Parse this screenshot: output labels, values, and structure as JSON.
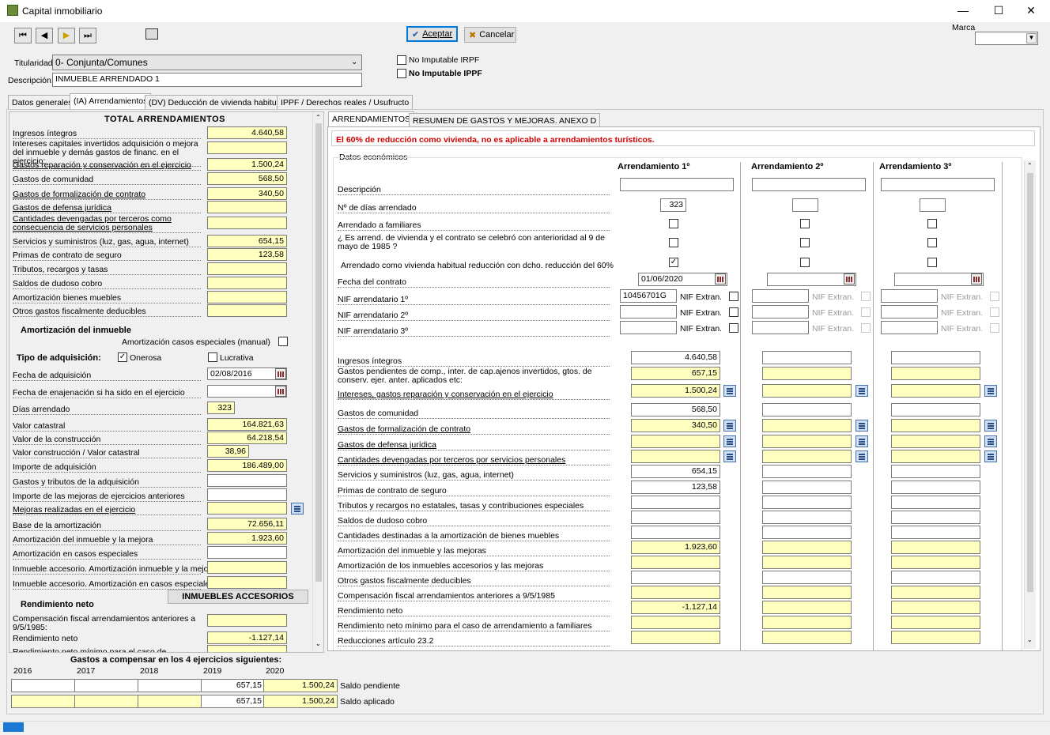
{
  "window": {
    "title": "Capital inmobiliario"
  },
  "toolbar": {
    "accept_label": "Aceptar",
    "cancel_label": "Cancelar",
    "marca_label": "Marca",
    "marca_value": ""
  },
  "header": {
    "titularidad_label": "Titularidad:",
    "titularidad_value": "0- Conjunta/Comunes",
    "descripcion_label": "Descripción:",
    "descripcion_value": "INMUEBLE ARRENDADO 1",
    "no_imputable_irpf": "No Imputable IRPF",
    "no_imputable_ippf": "No Imputable IPPF"
  },
  "tabs": [
    "Datos generales",
    "(IA) Arrendamientos",
    "(DV) Deducción de vivienda habitual",
    "IPPF / Derechos reales / Usufructo"
  ],
  "left": {
    "title": "TOTAL ARRENDAMIENTOS",
    "rows": [
      {
        "label": "Ingresos íntegros",
        "value": "4.640,58"
      },
      {
        "label": "Intereses capitales invertidos adquisición o mejora del inmueble y demás gastos de financ. en el ejercicio:",
        "value": ""
      },
      {
        "label": "Gastos reparación y conservación en el ejercicio",
        "value": "1.500,24"
      },
      {
        "label": "Gastos de comunidad",
        "value": "568,50"
      },
      {
        "label": "Gastos de formalización de contrato",
        "value": "340,50"
      },
      {
        "label": "Gastos de defensa jurídica",
        "value": ""
      },
      {
        "label": "Cantidades devengadas por terceros como consecuencia de servicios personales",
        "value": ""
      },
      {
        "label": "Servicios y suministros (luz, gas, agua, internet)",
        "value": "654,15"
      },
      {
        "label": "Primas de contrato de seguro",
        "value": "123,58"
      },
      {
        "label": "Tributos, recargos y tasas",
        "value": ""
      },
      {
        "label": "Saldos de dudoso cobro",
        "value": ""
      },
      {
        "label": "Amortización bienes muebles",
        "value": ""
      },
      {
        "label": "Otros gastos fiscalmente deducibles",
        "value": ""
      }
    ],
    "amort_title": "Amortización del inmueble",
    "amort_especiales": "Amortización casos especiales (manual)",
    "tipo_adq": "Tipo de adquisición:",
    "onerosa": "Onerosa",
    "lucrativa": "Lucrativa",
    "rows2": [
      {
        "label": "Fecha de adquisición",
        "value": "02/08/2016"
      },
      {
        "label": "Fecha de enajenación si ha sido en el ejercicio",
        "value": ""
      },
      {
        "label": "Días arrendado",
        "value": "323"
      },
      {
        "label": "Valor catastral",
        "value": "164.821,63"
      },
      {
        "label": "Valor de la construcción",
        "value": "64.218,54"
      },
      {
        "label": "Valor construcción / Valor catastral",
        "value": "38,96"
      },
      {
        "label": "Importe de adquisición",
        "value": "186.489,00"
      },
      {
        "label": "Gastos y tributos de la adquisición",
        "value": ""
      },
      {
        "label": "Importe de las mejoras de ejercicios anteriores",
        "value": ""
      },
      {
        "label": "Mejoras realizadas en el ejercicio",
        "value": ""
      },
      {
        "label": "Base de la amortización",
        "value": "72.656,11"
      },
      {
        "label": "Amortización del inmueble y la mejora",
        "value": "1.923,60"
      },
      {
        "label": "Amortización en casos especiales",
        "value": ""
      },
      {
        "label": "Inmueble accesorio. Amortización inmueble y la mejora",
        "value": ""
      },
      {
        "label": "Inmueble accesorio. Amortización en casos especiales",
        "value": ""
      }
    ],
    "accesorios_btn": "INMUEBLES ACCESORIOS",
    "rend_title": "Rendimiento neto",
    "rows3": [
      {
        "label": "Compensación fiscal arrendamientos anteriores a 9/5/1985:",
        "value": ""
      },
      {
        "label": "Rendimiento neto",
        "value": "-1.127,14"
      },
      {
        "label": "Rendimiento neto mínimo para el caso de arrendamiento",
        "value": ""
      }
    ]
  },
  "bottom": {
    "title": "Gastos a compensar en los 4 ejercicios siguientes:",
    "years": [
      "2016",
      "2017",
      "2018",
      "2019",
      "2020"
    ],
    "row1": [
      "",
      "",
      "",
      "657,15",
      "1.500,24"
    ],
    "row2": [
      "",
      "",
      "",
      "657,15",
      "1.500,24"
    ],
    "row1_label": "Saldo pendiente",
    "row2_label": "Saldo aplicado"
  },
  "right": {
    "tabs": [
      "ARRENDAMIENTOS",
      "RESUMEN DE GASTOS Y MEJORAS. ANEXO D"
    ],
    "warning": "El 60% de reducción como vivienda, no es aplicable a arrendamientos turísticos.",
    "group_label": "Datos económicos",
    "col_headers": [
      "Arrendamiento 1º",
      "Arrendamiento 2º",
      "Arrendamiento 3º"
    ],
    "descripcion": "Descripción",
    "dias": "Nº de días arrendado",
    "dias_values": [
      "323",
      "",
      ""
    ],
    "familiares": "Arrendado a familiares",
    "anterior": "¿ Es arrend. de vivienda y el contrato se celebró con anterioridad al 9 de mayo de 1985 ?",
    "habitual": "Arrendado como vivienda habitual reducción con dcho. reducción del 60%",
    "fecha_contrato": "Fecha del contrato",
    "fecha_values": [
      "01/06/2020",
      "",
      ""
    ],
    "nif1": "NIF arrendatario 1º",
    "nif2": "NIF arrendatario 2º",
    "nif3": "NIF arrendatario 3º",
    "nif_extran": "NIF Extran.",
    "nif1_value": "10456701G",
    "rows": [
      {
        "label": "Ingresos íntegros",
        "v1": "4.640,58",
        "y": false,
        "calc": false
      },
      {
        "label": "Gastos pendientes de comp., inter. de cap.ajenos invertidos, gtos. de conserv. ejer. anter. aplicados etc:",
        "v1": "657,15",
        "y": true,
        "calc": false
      },
      {
        "label": "Intereses, gastos reparación y conservación en el ejercicio",
        "v1": "1.500,24",
        "y": true,
        "calc": true
      },
      {
        "label": "Gastos de comunidad",
        "v1": "568,50",
        "y": false,
        "calc": false
      },
      {
        "label": "Gastos de formalización de contrato",
        "v1": "340,50",
        "y": true,
        "calc": true
      },
      {
        "label": "Gastos de defensa jurídica",
        "v1": "",
        "y": true,
        "calc": true
      },
      {
        "label": "Cantidades devengadas por terceros por servicios personales",
        "v1": "",
        "y": true,
        "calc": true
      },
      {
        "label": "Servicios y suministros (luz, gas, agua, internet)",
        "v1": "654,15",
        "y": false,
        "calc": false
      },
      {
        "label": "Primas de contrato de seguro",
        "v1": "123,58",
        "y": false,
        "calc": false
      },
      {
        "label": "Tributos y recargos no estatales, tasas y contribuciones especiales",
        "v1": "",
        "y": false,
        "calc": false
      },
      {
        "label": "Saldos de dudoso cobro",
        "v1": "",
        "y": false,
        "calc": false
      },
      {
        "label": "Cantidades destinadas a la amortización de bienes muebles",
        "v1": "",
        "y": false,
        "calc": false
      },
      {
        "label": "Amortización del inmueble y las mejoras",
        "v1": "1.923,60",
        "y": true,
        "calc": false
      },
      {
        "label": "Amortización de los inmuebles accesorios y las mejoras",
        "v1": "",
        "y": true,
        "calc": false
      },
      {
        "label": "Otros gastos fiscalmente deducibles",
        "v1": "",
        "y": false,
        "calc": false
      },
      {
        "label": "Compensación fiscal arrendamientos anteriores a 9/5/1985",
        "v1": "",
        "y": true,
        "calc": false
      },
      {
        "label": "Rendimiento neto",
        "v1": "-1.127,14",
        "y": true,
        "calc": false
      },
      {
        "label": "Rendimiento neto mínimo para el caso de arrendamiento a familiares",
        "v1": "",
        "y": true,
        "calc": false
      },
      {
        "label": "Reducciones artículo 23.2",
        "v1": "",
        "y": true,
        "calc": false
      }
    ]
  }
}
